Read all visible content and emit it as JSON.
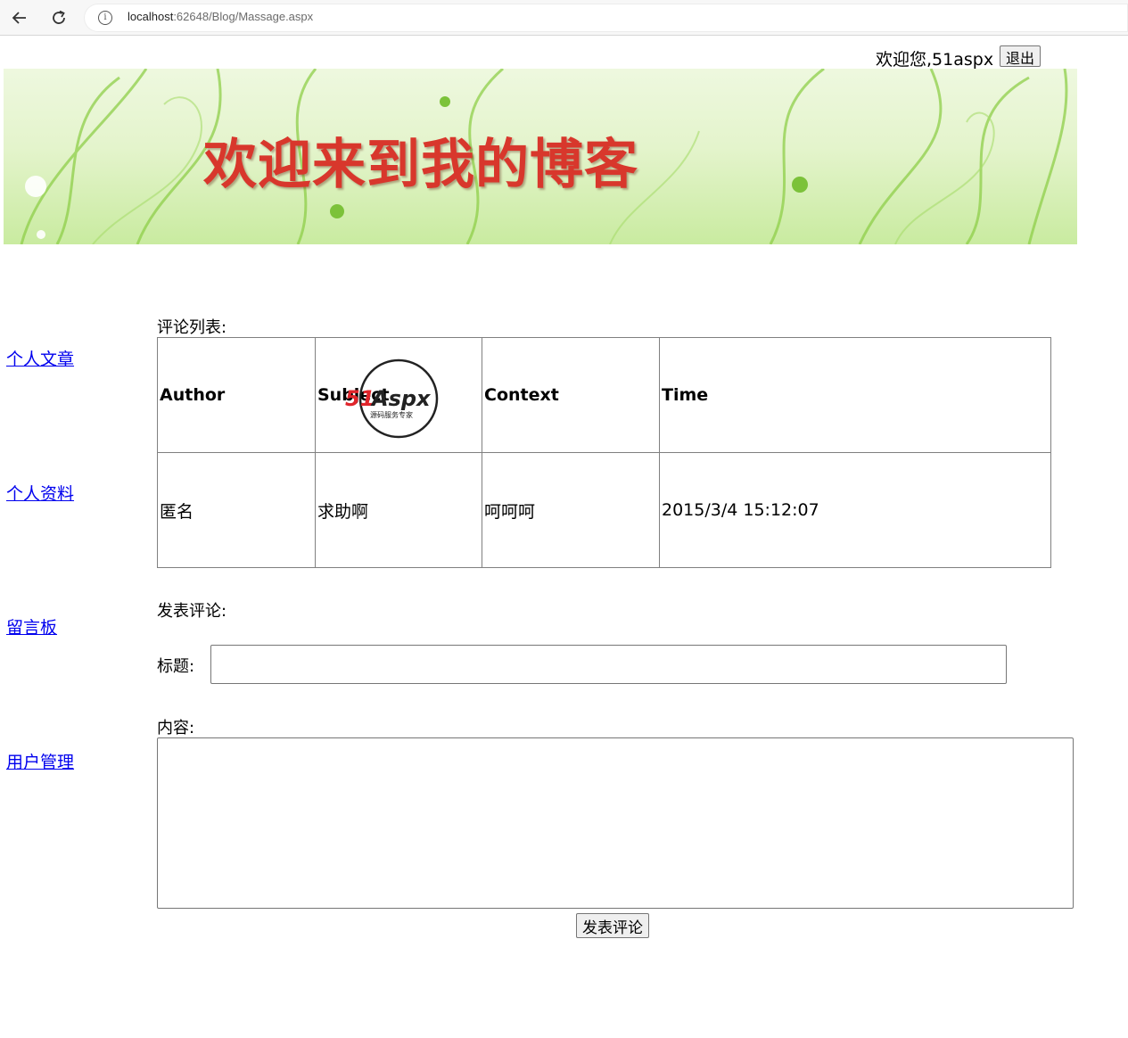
{
  "browser": {
    "url_host": "localhost",
    "url_rest": ":62648/Blog/Massage.aspx"
  },
  "header": {
    "welcome_text": "欢迎您,51aspx",
    "logout_label": "退出",
    "banner_text": "欢迎来到我的博客"
  },
  "sidebar": {
    "items": [
      {
        "label": "个人文章"
      },
      {
        "label": "个人资料"
      },
      {
        "label": "留言板"
      },
      {
        "label": "用户管理"
      }
    ]
  },
  "comments": {
    "section_label": "评论列表:",
    "columns": [
      "Author",
      "Subject",
      "Context",
      "Time"
    ],
    "rows": [
      [
        "匿名",
        "求助啊",
        "呵呵呵",
        "2015/3/4 15:12:07"
      ]
    ]
  },
  "form": {
    "section_label": "发表评论:",
    "title_label": "标题:",
    "title_value": "",
    "content_label": "内容:",
    "content_value": "",
    "submit_label": "发表评论"
  },
  "watermark": {
    "brand": "51Aspx",
    "tagline": "源码服务专家"
  }
}
